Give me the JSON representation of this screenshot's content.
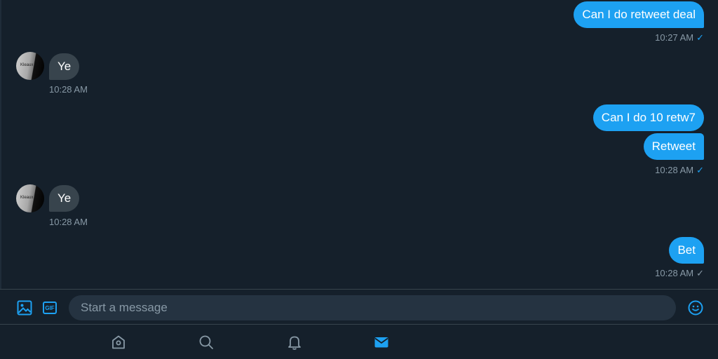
{
  "conversation": {
    "messages": [
      {
        "id": "m1",
        "direction": "outgoing",
        "text": "Can I do retweet deal"
      },
      {
        "id": "m2",
        "direction": "incoming",
        "text": "Ye",
        "time": "10:28 AM"
      },
      {
        "id": "m3",
        "direction": "outgoing",
        "text": "Can I do 10 retw7"
      },
      {
        "id": "m4",
        "direction": "outgoing",
        "text": "Retweet"
      },
      {
        "id": "m5",
        "direction": "incoming",
        "text": "Ye",
        "time": "10:28 AM"
      },
      {
        "id": "m6",
        "direction": "outgoing",
        "text": "Bet"
      }
    ],
    "receipts": [
      {
        "time": "10:27 AM",
        "check": "✓",
        "status": "read",
        "color": "#1da1f2"
      },
      {
        "time": "10:28 AM",
        "check": "✓",
        "status": "read",
        "color": "#1da1f2"
      },
      {
        "time": "10:28 AM",
        "check": "✓",
        "status": "sent",
        "color": "#8899a6"
      }
    ],
    "avatar_text": "Kleaux"
  },
  "composer": {
    "placeholder": "Start a message",
    "value": "",
    "gif_label": "GIF",
    "icons": [
      "image-icon",
      "gif-icon",
      "emoji-icon"
    ]
  },
  "tabbar": {
    "items": [
      {
        "name": "home",
        "icon": "home-icon",
        "active": false
      },
      {
        "name": "search",
        "icon": "search-icon",
        "active": false
      },
      {
        "name": "notifications",
        "icon": "bell-icon",
        "active": false
      },
      {
        "name": "messages",
        "icon": "mail-icon",
        "active": true
      }
    ]
  },
  "colors": {
    "background": "#15202b",
    "accent": "#1da1f2",
    "incoming_bubble": "#38444d",
    "secondary_text": "#8899a6",
    "input_background": "#253341"
  }
}
